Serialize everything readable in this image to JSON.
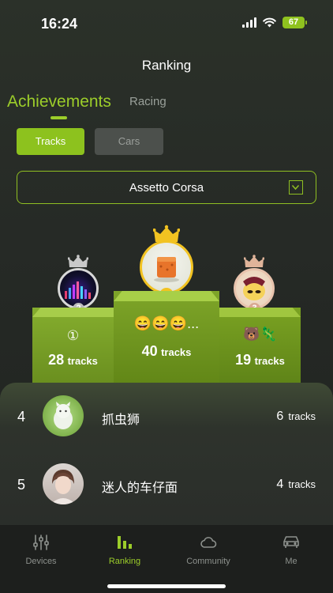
{
  "status": {
    "time": "16:24",
    "battery": "67"
  },
  "header": {
    "title": "Ranking"
  },
  "segments": {
    "active": "Achievements",
    "inactive": "Racing"
  },
  "filters": {
    "tracks": "Tracks",
    "cars": "Cars"
  },
  "game_select": {
    "value": "Assetto Corsa"
  },
  "podium": {
    "first": {
      "rank": "1",
      "name": "😄😄😄...",
      "count": "40",
      "unit": "tracks"
    },
    "second": {
      "rank": "2",
      "name": "①",
      "count": "28",
      "unit": "tracks"
    },
    "third": {
      "rank": "3",
      "name": "🐻🦎",
      "count": "19",
      "unit": "tracks"
    }
  },
  "list": [
    {
      "rank": "4",
      "name": "抓虫狮",
      "count": "6",
      "unit": "tracks"
    },
    {
      "rank": "5",
      "name": "迷人的车仔面",
      "count": "4",
      "unit": "tracks"
    }
  ],
  "tabbar": [
    {
      "label": "Devices",
      "icon": "sliders-icon",
      "active": false
    },
    {
      "label": "Ranking",
      "icon": "bar-chart-icon",
      "active": true
    },
    {
      "label": "Community",
      "icon": "cloud-icon",
      "active": false
    },
    {
      "label": "Me",
      "icon": "car-icon",
      "active": false
    }
  ],
  "colors": {
    "accent": "#9ccd2a",
    "gold": "#f2c321",
    "silver": "#b9b9b9",
    "bronze": "#d9a991"
  }
}
